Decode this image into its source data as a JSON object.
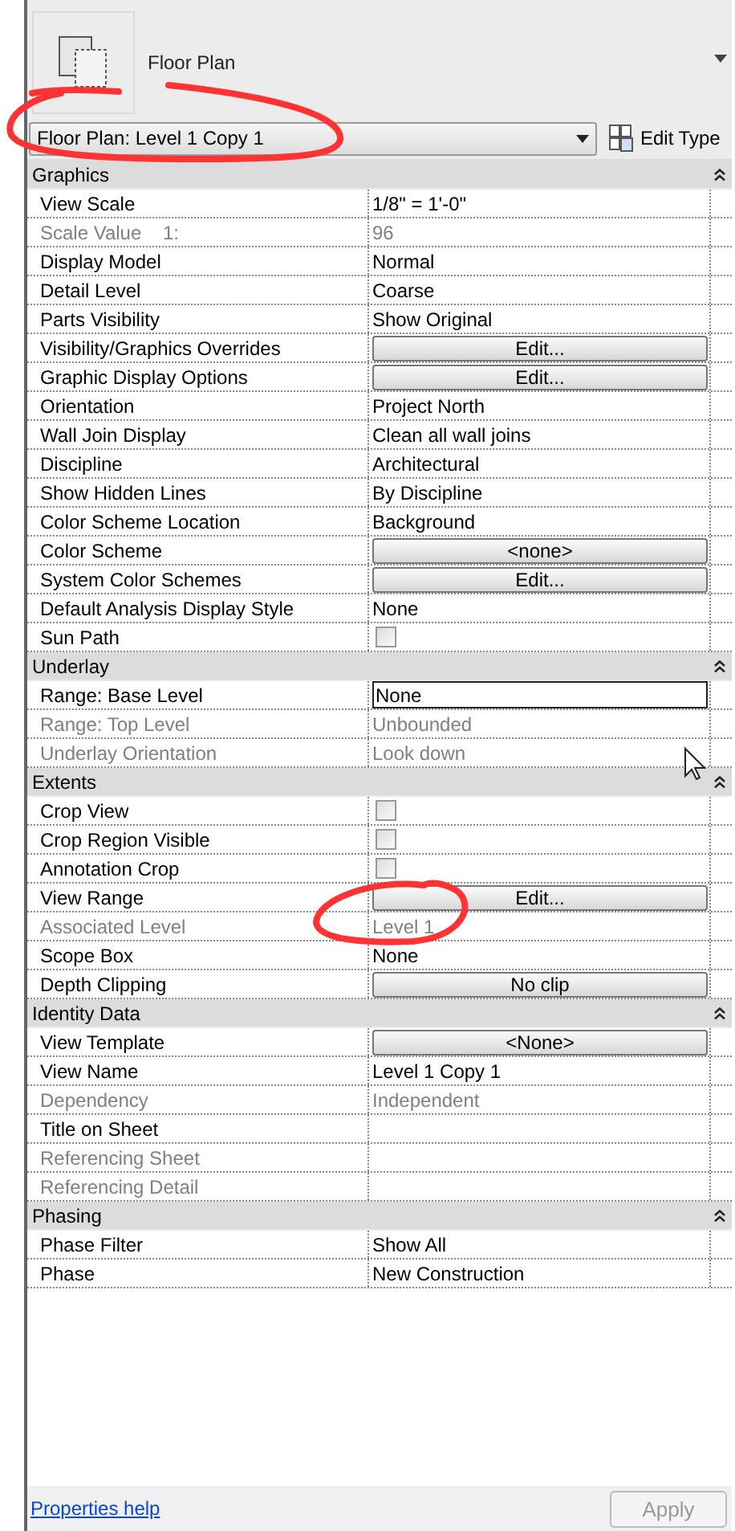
{
  "header": {
    "family": "Floor Plan",
    "type_selector": "Floor Plan: Level 1 Copy 1",
    "edit_type": "Edit Type"
  },
  "groups": [
    {
      "title": "Graphics",
      "rows": [
        {
          "label": "View Scale",
          "kind": "text",
          "value": "1/8\" = 1'-0\"",
          "disabled": false
        },
        {
          "label": "Scale Value    1:",
          "kind": "text",
          "value": "96",
          "disabled": true
        },
        {
          "label": "Display Model",
          "kind": "text",
          "value": "Normal",
          "disabled": false
        },
        {
          "label": "Detail Level",
          "kind": "text",
          "value": "Coarse",
          "disabled": false
        },
        {
          "label": "Parts Visibility",
          "kind": "text",
          "value": "Show Original",
          "disabled": false
        },
        {
          "label": "Visibility/Graphics Overrides",
          "kind": "button",
          "value": "Edit...",
          "disabled": false
        },
        {
          "label": "Graphic Display Options",
          "kind": "button",
          "value": "Edit...",
          "disabled": false
        },
        {
          "label": "Orientation",
          "kind": "text",
          "value": "Project North",
          "disabled": false
        },
        {
          "label": "Wall Join Display",
          "kind": "text",
          "value": "Clean all wall joins",
          "disabled": false
        },
        {
          "label": "Discipline",
          "kind": "text",
          "value": "Architectural",
          "disabled": false
        },
        {
          "label": "Show Hidden Lines",
          "kind": "text",
          "value": "By Discipline",
          "disabled": false
        },
        {
          "label": "Color Scheme Location",
          "kind": "text",
          "value": "Background",
          "disabled": false
        },
        {
          "label": "Color Scheme",
          "kind": "button",
          "value": "<none>",
          "disabled": false
        },
        {
          "label": "System Color Schemes",
          "kind": "button",
          "value": "Edit...",
          "disabled": false
        },
        {
          "label": "Default Analysis Display Style",
          "kind": "text",
          "value": "None",
          "disabled": false
        },
        {
          "label": "Sun Path",
          "kind": "checkbox",
          "checked": false,
          "disabled": false
        }
      ]
    },
    {
      "title": "Underlay",
      "rows": [
        {
          "label": "Range: Base Level",
          "kind": "field",
          "value": "None",
          "disabled": false
        },
        {
          "label": "Range: Top Level",
          "kind": "text",
          "value": "Unbounded",
          "disabled": true
        },
        {
          "label": "Underlay Orientation",
          "kind": "text",
          "value": "Look down",
          "disabled": true
        }
      ]
    },
    {
      "title": "Extents",
      "rows": [
        {
          "label": "Crop View",
          "kind": "checkbox",
          "checked": false,
          "disabled": false
        },
        {
          "label": "Crop Region Visible",
          "kind": "checkbox",
          "checked": false,
          "disabled": false
        },
        {
          "label": "Annotation Crop",
          "kind": "checkbox",
          "checked": false,
          "disabled": false
        },
        {
          "label": "View Range",
          "kind": "button",
          "value": "Edit...",
          "disabled": false
        },
        {
          "label": "Associated Level",
          "kind": "text",
          "value": "Level 1",
          "disabled": true
        },
        {
          "label": "Scope Box",
          "kind": "text",
          "value": "None",
          "disabled": false
        },
        {
          "label": "Depth Clipping",
          "kind": "button",
          "value": "No clip",
          "disabled": false
        }
      ]
    },
    {
      "title": "Identity Data",
      "rows": [
        {
          "label": "View Template",
          "kind": "button",
          "value": "<None>",
          "disabled": false
        },
        {
          "label": "View Name",
          "kind": "text",
          "value": "Level 1 Copy 1",
          "disabled": false
        },
        {
          "label": "Dependency",
          "kind": "text",
          "value": "Independent",
          "disabled": true
        },
        {
          "label": "Title on Sheet",
          "kind": "text",
          "disabled": false
        },
        {
          "label": "Referencing Sheet",
          "kind": "text",
          "disabled": true
        },
        {
          "label": "Referencing Detail",
          "kind": "text",
          "disabled": true
        }
      ]
    },
    {
      "title": "Phasing",
      "rows": [
        {
          "label": "Phase Filter",
          "kind": "text",
          "value": "Show All",
          "disabled": false
        },
        {
          "label": "Phase",
          "kind": "text",
          "value": "New Construction",
          "disabled": false
        }
      ]
    }
  ],
  "footer": {
    "help_link": "Properties help",
    "apply": {
      "label": "Apply",
      "disabled": true
    }
  }
}
